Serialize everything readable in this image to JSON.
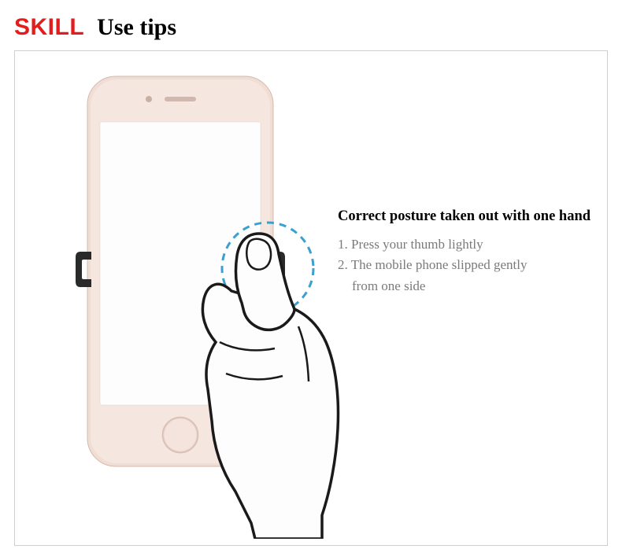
{
  "header": {
    "skill_label": "SKILL",
    "subtitle": "Use tips"
  },
  "instructions": {
    "title": "Correct posture taken out with one hand",
    "step1": "1. Press your thumb lightly",
    "step2": "2. The mobile phone slipped gently",
    "step2_cont": "from one side"
  },
  "colors": {
    "accent_red": "#e11d1d",
    "dashed_blue": "#3aa0cf",
    "phone_rose": "#e8cfc6",
    "text_gray": "#7a7a7a"
  }
}
